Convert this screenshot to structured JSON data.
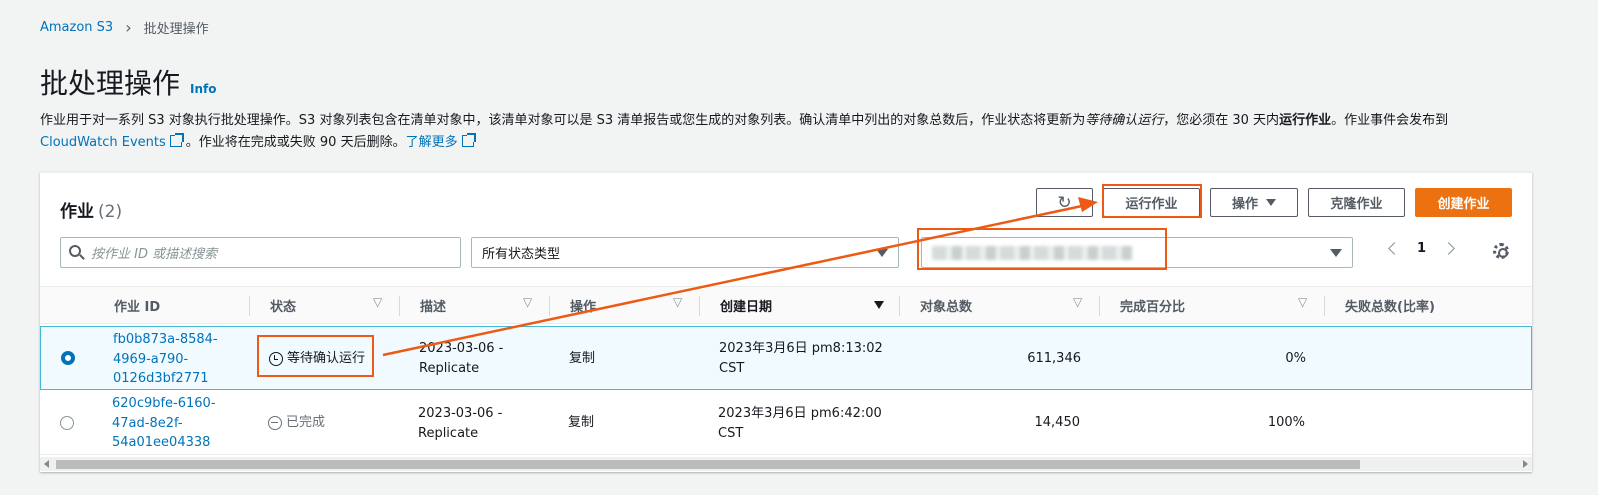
{
  "breadcrumb": {
    "root": "Amazon S3",
    "current": "批处理操作"
  },
  "page": {
    "title": "批处理操作",
    "info": "Info"
  },
  "description": {
    "part1": "作业用于对一系列 S3 对象执行批处理操作。S3 对象列表包含在清单对象中，该清单对象可以是 S3 清单报告或您生成的对象列表。确认清单中列出的对象总数后，作业状态将更新为",
    "italic": "等待确认运行",
    "part2": "，您必须在 30 天内",
    "bold": "运行作业",
    "part3": "。作业事件会发布到",
    "link1": "CloudWatch Events",
    "part4": "。作业将在完成或失败 90 天后删除。",
    "link2": "了解更多"
  },
  "panel": {
    "title": "作业",
    "count": "(2)",
    "buttons": {
      "run": "运行作业",
      "actions": "操作",
      "clone": "克隆作业",
      "create": "创建作业"
    },
    "search_placeholder": "按作业 ID 或描述搜索",
    "status_filter": "所有状态类型",
    "page_number": "1"
  },
  "columns": [
    "作业 ID",
    "状态",
    "描述",
    "操作",
    "创建日期",
    "对象总数",
    "完成百分比",
    "失败总数(比率)"
  ],
  "rows": [
    {
      "id": [
        "fb0b873a-8584-",
        "4969-a790-",
        "0126d3bf2771"
      ],
      "status": "等待确认运行",
      "desc": [
        "2023-03-06 -",
        "Replicate"
      ],
      "op": "复制",
      "date": [
        "2023年3月6日 pm8:13:02",
        "CST"
      ],
      "total": "611,346",
      "percent": "0%"
    },
    {
      "id": [
        "620c9bfe-6160-",
        "47ad-8e2f-",
        "54a01ee04338"
      ],
      "status": "已完成",
      "desc": [
        "2023-03-06 -",
        "Replicate"
      ],
      "op": "复制",
      "date": [
        "2023年3月6日 pm6:42:00",
        "CST"
      ],
      "total": "14,450",
      "percent": "100%"
    }
  ],
  "colors": {
    "accent": "#ec7211",
    "link": "#0073bb",
    "annotation": "#ec5a14",
    "selected_row": "#f1faff"
  }
}
